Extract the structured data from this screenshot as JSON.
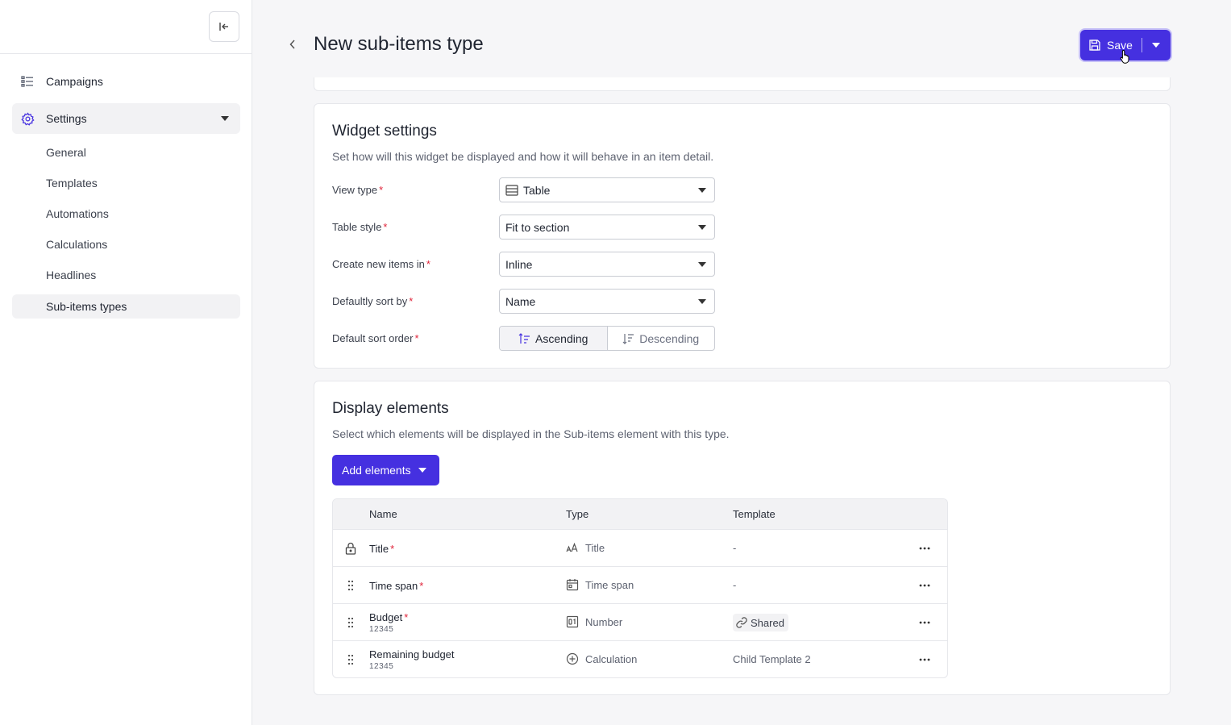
{
  "sidebar": {
    "collapse_icon": "collapse-left-icon",
    "nav": [
      {
        "label": "Campaigns",
        "icon": "list-icon"
      },
      {
        "label": "Settings",
        "icon": "gear-icon"
      }
    ],
    "settings_items": [
      "General",
      "Templates",
      "Automations",
      "Calculations",
      "Headlines",
      "Sub-items types"
    ],
    "active_item": "Sub-items types"
  },
  "header": {
    "title": "New sub-items type",
    "save_label": "Save"
  },
  "widget_settings": {
    "title": "Widget settings",
    "description": "Set how will this widget be displayed and how it will behave in an item detail.",
    "fields": {
      "view_type": {
        "label": "View type",
        "value": "Table"
      },
      "table_style": {
        "label": "Table style",
        "value": "Fit to section"
      },
      "create_new_in": {
        "label": "Create new items in",
        "value": "Inline"
      },
      "sort_by": {
        "label": "Defaultly sort by",
        "value": "Name"
      },
      "sort_order": {
        "label": "Default sort order",
        "options": [
          "Ascending",
          "Descending"
        ],
        "selected": "Ascending"
      }
    },
    "required_mark": "*"
  },
  "display_elements": {
    "title": "Display elements",
    "description": "Select which elements will be displayed in the Sub-items element with this type.",
    "add_button": "Add elements",
    "columns": {
      "name": "Name",
      "type": "Type",
      "template": "Template"
    },
    "rows": [
      {
        "name": "Title",
        "required": true,
        "sub": "",
        "type": "Title",
        "type_icon": "text-size-icon",
        "template": "-",
        "lock": true
      },
      {
        "name": "Time span",
        "required": true,
        "sub": "",
        "type": "Time span",
        "type_icon": "calendar-icon",
        "template": "-",
        "lock": false
      },
      {
        "name": "Budget",
        "required": true,
        "sub": "12345",
        "type": "Number",
        "type_icon": "number-icon",
        "template": "Shared",
        "lock": false
      },
      {
        "name": "Remaining budget",
        "required": false,
        "sub": "12345",
        "type": "Calculation",
        "type_icon": "plus-circle-icon",
        "template": "Child Template 2",
        "lock": false
      }
    ]
  },
  "colors": {
    "accent": "#4530e0",
    "required": "#e0243a"
  }
}
